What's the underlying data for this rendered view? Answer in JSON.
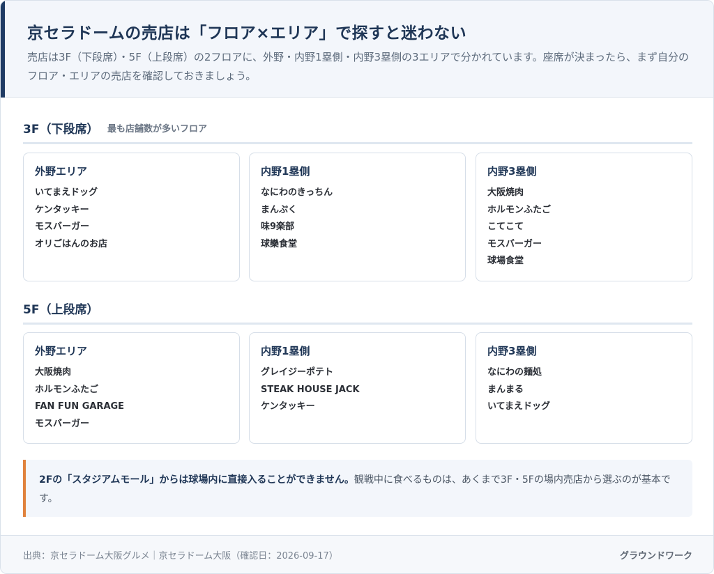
{
  "header": {
    "title": "京セラドームの売店は「フロア×エリア」で探すと迷わない",
    "lead": "売店は3F（下段席）・5F（上段席）の2フロアに、外野・内野1塁側・内野3塁側の3エリアで分かれています。座席が決まったら、まず自分のフロア・エリアの売店を確認しておきましょう。"
  },
  "floors": [
    {
      "title": "3F（下段席）",
      "note": "最も店舗数が多いフロア",
      "areas": [
        {
          "name": "外野エリア",
          "shops": [
            "いてまえドッグ",
            "ケンタッキー",
            "モスバーガー",
            "オリごはんのお店"
          ]
        },
        {
          "name": "内野1塁側",
          "shops": [
            "なにわのきっちん",
            "まんぷく",
            "味9楽部",
            "球欒食堂"
          ]
        },
        {
          "name": "内野3塁側",
          "shops": [
            "大阪焼肉",
            "ホルモンふたご",
            "こてこて",
            "モスバーガー",
            "球場食堂"
          ]
        }
      ]
    },
    {
      "title": "5F（上段席）",
      "note": "",
      "areas": [
        {
          "name": "外野エリア",
          "shops": [
            "大阪焼肉",
            "ホルモンふたご",
            "FAN FUN GARAGE",
            "モスバーガー"
          ]
        },
        {
          "name": "内野1塁側",
          "shops": [
            "グレイジーポテト",
            "STEAK HOUSE JACK",
            "ケンタッキー"
          ]
        },
        {
          "name": "内野3塁側",
          "shops": [
            "なにわの麺処",
            "まんまる",
            "いてまえドッグ"
          ]
        }
      ]
    }
  ],
  "notice": {
    "strong": "2Fの「スタジアムモール」からは球場内に直接入ることができません。",
    "rest": "観戦中に食べるものは、あくまで3F・5Fの場内売店から選ぶのが基本です。"
  },
  "footer": {
    "source": "出典：京セラドーム大阪グルメ｜京セラドーム大阪（確認日：2026-09-17）",
    "brand": "グラウンドワーク"
  },
  "colors": {
    "accent": "#1f3b64",
    "notice_border": "#e0823d",
    "header_bg": "#f3f6fb"
  }
}
